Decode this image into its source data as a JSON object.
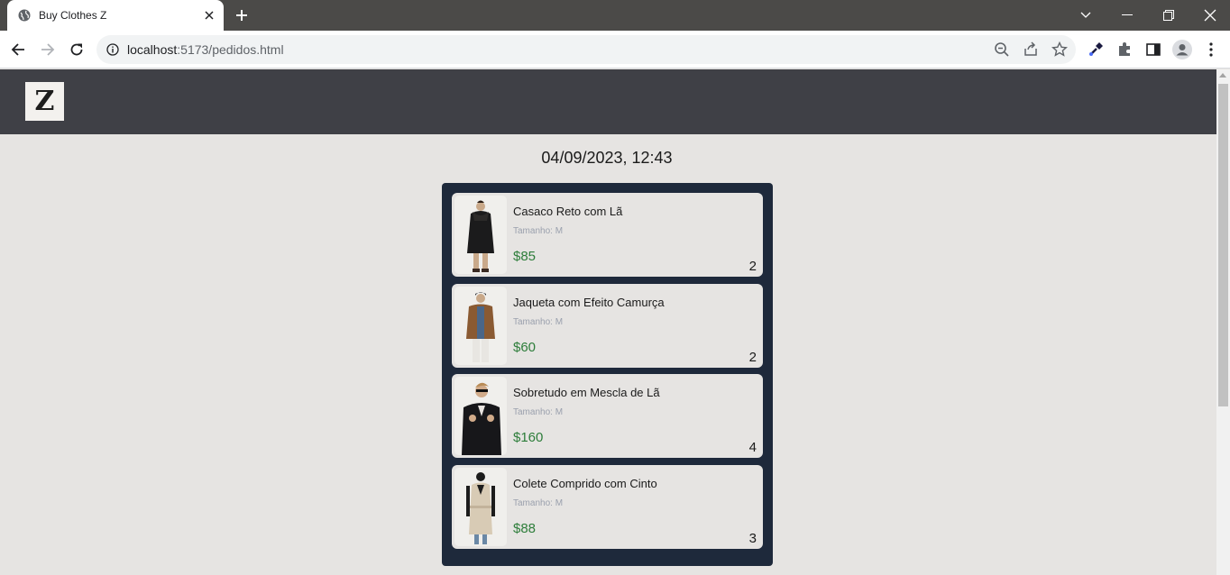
{
  "browser": {
    "tab_title": "Buy Clothes Z",
    "url_host": "localhost",
    "url_path": ":5173/pedidos.html"
  },
  "header": {
    "logo_letter": "Z"
  },
  "order": {
    "date": "04/09/2023, 12:43",
    "items": [
      {
        "name": "Casaco Reto com Lã",
        "size": "Tamanho: M",
        "price": "$85",
        "quantity": "2"
      },
      {
        "name": "Jaqueta com Efeito Camurça",
        "size": "Tamanho: M",
        "price": "$60",
        "quantity": "2"
      },
      {
        "name": "Sobretudo em Mescla de Lã",
        "size": "Tamanho: M",
        "price": "$160",
        "quantity": "4"
      },
      {
        "name": "Colete Comprido com Cinto",
        "size": "Tamanho: M",
        "price": "$88",
        "quantity": "3"
      }
    ]
  },
  "colors": {
    "header_bg": "#3f4046",
    "panel_bg": "#1e293b",
    "price": "#2d7d3a"
  }
}
